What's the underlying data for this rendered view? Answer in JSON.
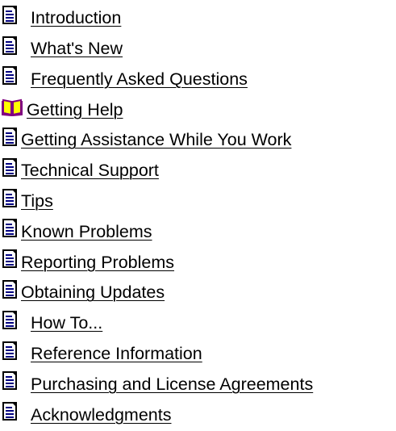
{
  "toc": {
    "items": [
      {
        "label": "Introduction",
        "icon": "page-icon"
      },
      {
        "label": "What's New",
        "icon": "page-icon"
      },
      {
        "label": "Frequently Asked Questions",
        "icon": "page-icon"
      },
      {
        "label": "Getting Help",
        "icon": "book-icon"
      },
      {
        "label": "Getting Assistance While You Work",
        "icon": "page-icon"
      },
      {
        "label": "Technical Support",
        "icon": "page-icon"
      },
      {
        "label": "Tips",
        "icon": "page-icon"
      },
      {
        "label": "Known Problems",
        "icon": "page-icon"
      },
      {
        "label": "Reporting Problems",
        "icon": "page-icon"
      },
      {
        "label": "Obtaining Updates",
        "icon": "page-icon"
      },
      {
        "label": "How To...",
        "icon": "page-icon"
      },
      {
        "label": "Reference Information",
        "icon": "page-icon"
      },
      {
        "label": "Purchasing and License Agreements",
        "icon": "page-icon"
      },
      {
        "label": "Acknowledgments",
        "icon": "page-icon"
      }
    ]
  },
  "colors": {
    "page_icon_fill": "#ffffff",
    "page_icon_border": "#000000",
    "page_icon_lines": "#000080",
    "book_icon_fill": "#ffff00",
    "book_icon_cover": "#800080",
    "link_text": "#000000"
  }
}
